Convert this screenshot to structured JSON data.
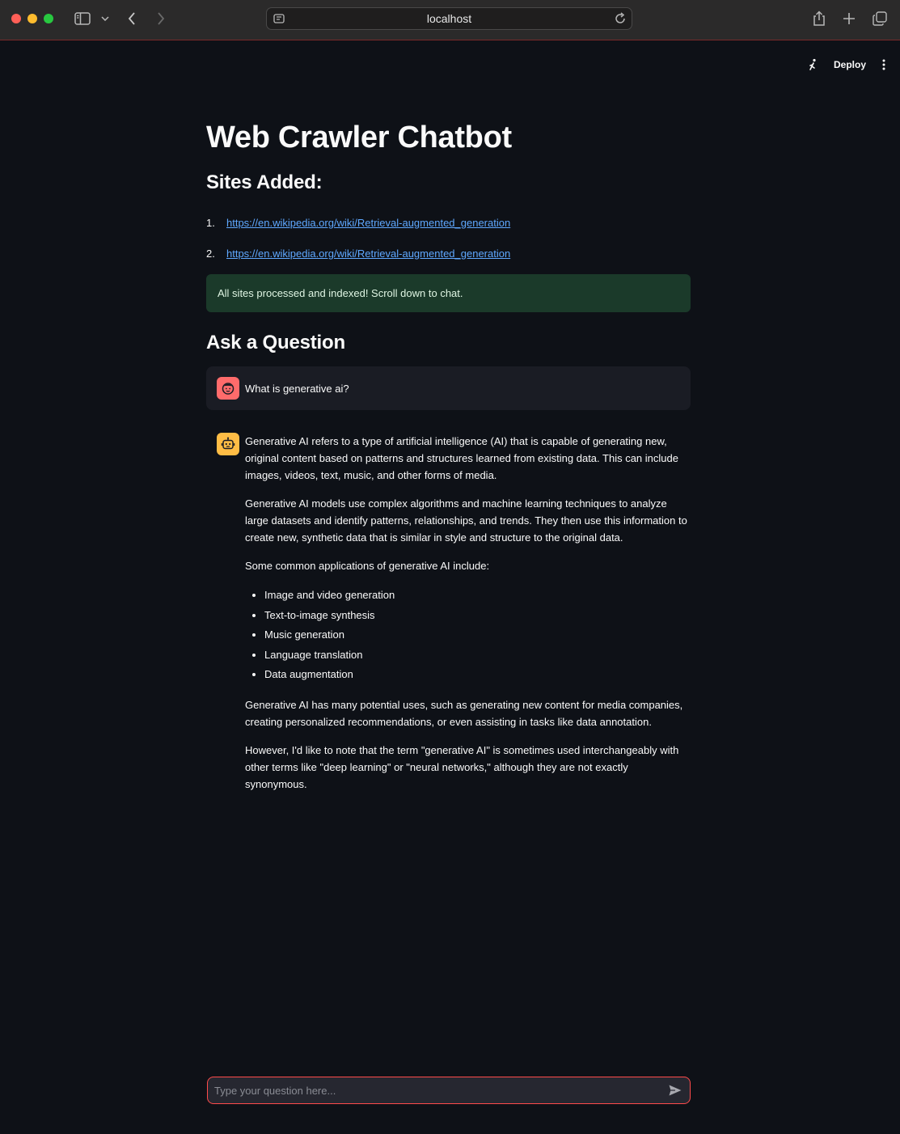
{
  "browser": {
    "url": "localhost"
  },
  "toolbar": {
    "deploy_label": "Deploy"
  },
  "app": {
    "title": "Web Crawler Chatbot",
    "sites_heading": "Sites Added:",
    "sites": [
      {
        "num": "1.",
        "url": "https://en.wikipedia.org/wiki/Retrieval-augmented_generation"
      },
      {
        "num": "2.",
        "url": "https://en.wikipedia.org/wiki/Retrieval-augmented_generation"
      }
    ],
    "success_message": "All sites processed and indexed! Scroll down to chat.",
    "ask_heading": "Ask a Question"
  },
  "chat": {
    "user_message": "What is generative ai?",
    "bot": {
      "p1": "Generative AI refers to a type of artificial intelligence (AI) that is capable of generating new, original content based on patterns and structures learned from existing data. This can include images, videos, text, music, and other forms of media.",
      "p2": "Generative AI models use complex algorithms and machine learning techniques to analyze large datasets and identify patterns, relationships, and trends. They then use this information to create new, synthetic data that is similar in style and structure to the original data.",
      "p3": "Some common applications of generative AI include:",
      "list": [
        "Image and video generation",
        "Text-to-image synthesis",
        "Music generation",
        "Language translation",
        "Data augmentation"
      ],
      "p4": "Generative AI has many potential uses, such as generating new content for media companies, creating personalized recommendations, or even assisting in tasks like data annotation.",
      "p5": "However, I'd like to note that the term \"generative AI\" is sometimes used interchangeably with other terms like \"deep learning\" or \"neural networks,\" although they are not exactly synonymous."
    },
    "input_placeholder": "Type your question here..."
  },
  "colors": {
    "background": "#0e1117",
    "accent": "#ff4b4b",
    "link": "#5fa8ff",
    "success_bg": "#1b3a2a",
    "user_avatar": "#ff6b6b",
    "bot_avatar": "#ffbd45"
  }
}
